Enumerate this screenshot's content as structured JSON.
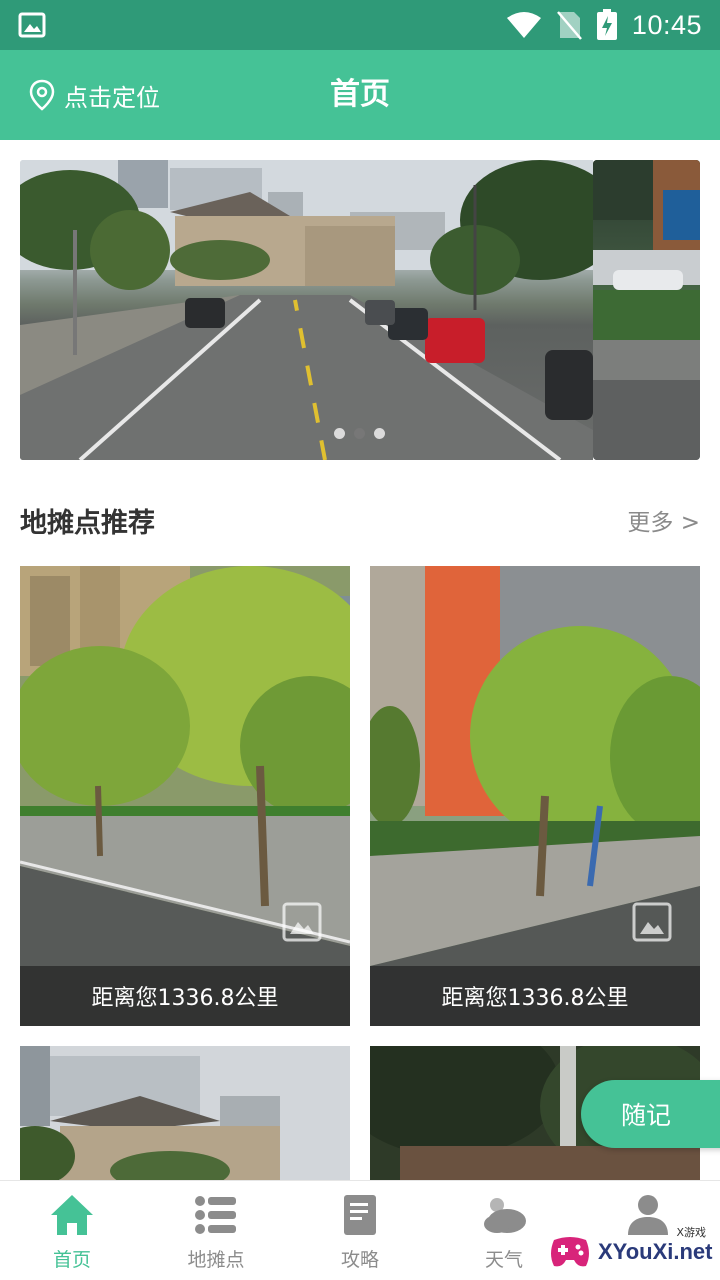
{
  "status_bar": {
    "time": "10:45",
    "icons": [
      "image-icon",
      "wifi-icon",
      "no-sim-icon",
      "battery-charging-icon"
    ]
  },
  "header": {
    "location_label": "点击定位",
    "title": "首页",
    "location_icon": "location-pin-icon"
  },
  "banner": {
    "dots": 3,
    "active_index": 1
  },
  "section": {
    "title": "地摊点推荐",
    "more_label": "更多 >"
  },
  "cards": [
    {
      "distance": "距离您1336.8公里"
    },
    {
      "distance": "距离您1336.8公里"
    }
  ],
  "fab": {
    "label": "随记"
  },
  "bottom_nav": {
    "items": [
      {
        "label": "首页",
        "icon": "home-icon",
        "active": true
      },
      {
        "label": "地摊点",
        "icon": "list-icon",
        "active": false
      },
      {
        "label": "攻略",
        "icon": "book-icon",
        "active": false
      },
      {
        "label": "天气",
        "icon": "weather-icon",
        "active": false
      },
      {
        "label": "",
        "icon": "profile-icon",
        "active": false
      }
    ]
  },
  "watermark": {
    "text": "XYouXi.net",
    "small": "X游戏"
  },
  "colors": {
    "primary": "#45c296",
    "status_bar": "#2f9a78"
  }
}
